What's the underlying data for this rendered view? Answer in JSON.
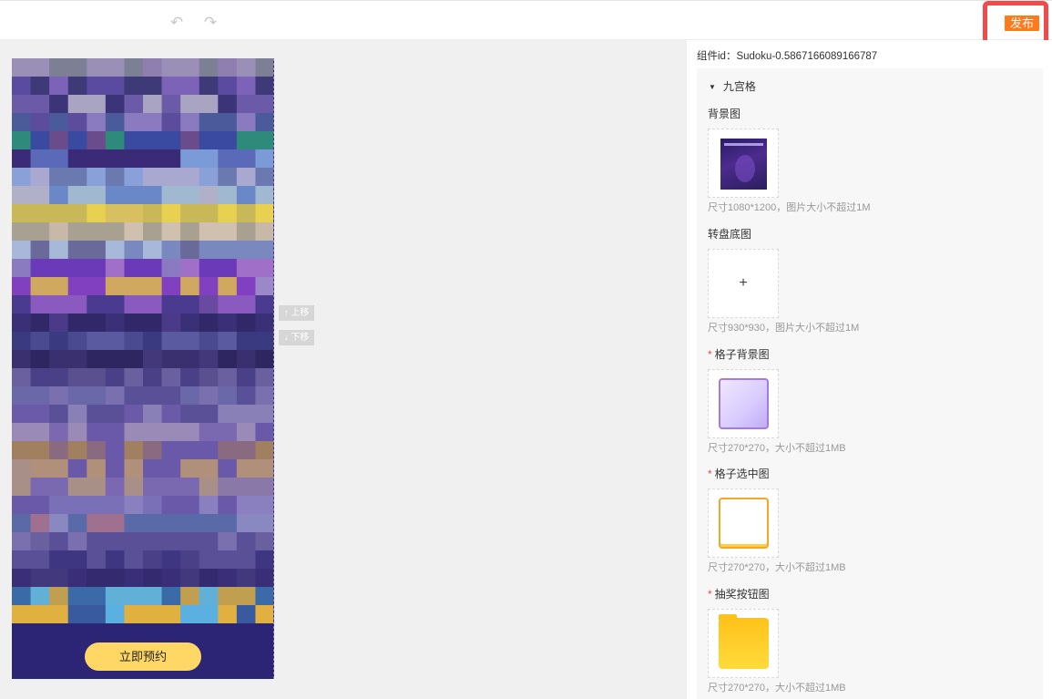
{
  "toolbar": {
    "undo_icon": "undo-icon",
    "redo_icon": "redo-icon",
    "publish_label": "发布"
  },
  "canvas": {
    "reserve_button_label": "立即预约",
    "move_up_label": "↑ 上移",
    "move_down_label": "↓ 下移"
  },
  "panel": {
    "component_id": "组件id：Sudoku-0.5867166089166787",
    "section_title": "九宫格",
    "fields": [
      {
        "label": "背景图",
        "required": false,
        "hint": "尺寸1080*1200，图片大小不超过1M"
      },
      {
        "label": "转盘底图",
        "required": false,
        "hint": "尺寸930*930，图片大小不超过1M"
      },
      {
        "label": "格子背景图",
        "required": true,
        "hint": "尺寸270*270，大小不超过1MB"
      },
      {
        "label": "格子选中图",
        "required": true,
        "hint": "尺寸270*270，大小不超过1MB"
      },
      {
        "label": "抽奖按钮图",
        "required": true,
        "hint": "尺寸270*270，大小不超过1MB"
      }
    ],
    "required_mark": "*",
    "plus_glyph": "+"
  },
  "colors": {
    "accent_orange": "#ff7a1a",
    "highlight_red": "#f04a4a",
    "phone_bg": "#2d2560",
    "reserve_button": "#ffd765"
  }
}
